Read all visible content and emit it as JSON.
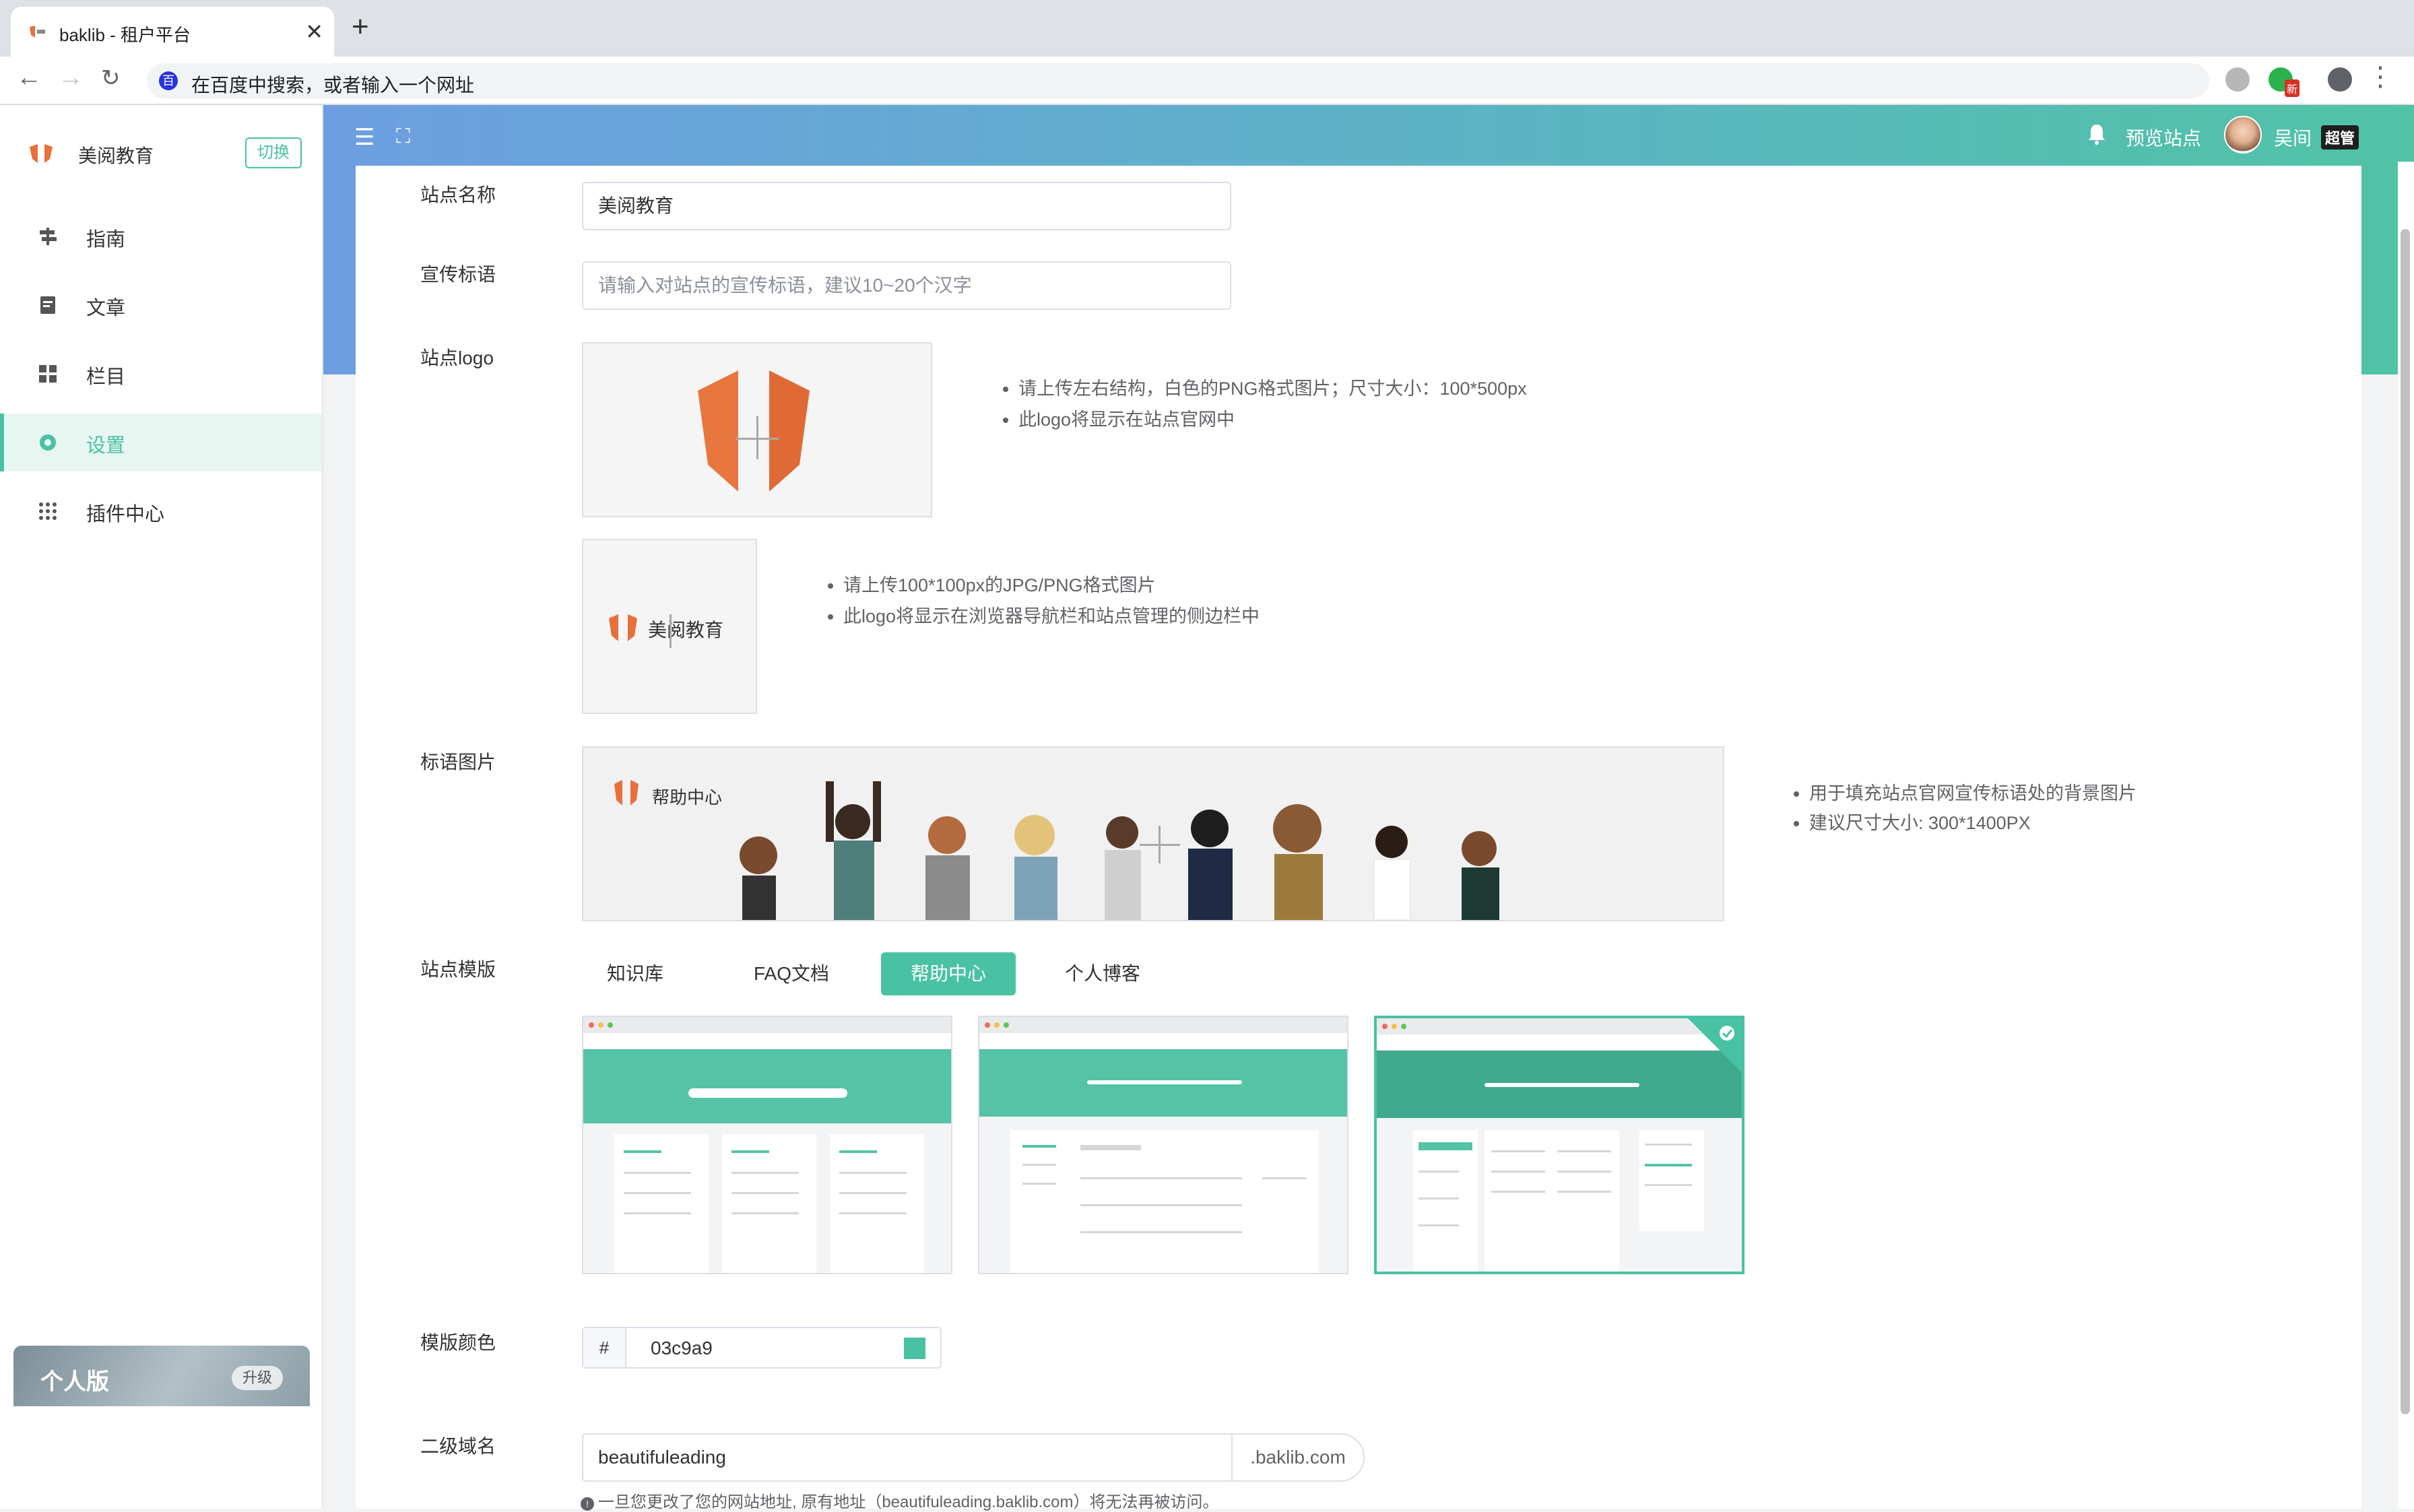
{
  "browser": {
    "tab_title": "baklib - 租户平台",
    "address_placeholder": "在百度中搜索，或者输入一个网址",
    "extension_badge": "新"
  },
  "sidebar": {
    "brand_name": "美阅教育",
    "switch_label": "切换",
    "items": [
      {
        "label": "指南",
        "icon": "signpost-icon",
        "active": false
      },
      {
        "label": "文章",
        "icon": "document-icon",
        "active": false
      },
      {
        "label": "栏目",
        "icon": "grid-icon",
        "active": false
      },
      {
        "label": "设置",
        "icon": "gear-icon",
        "active": true
      },
      {
        "label": "插件中心",
        "icon": "apps-icon",
        "active": false
      }
    ],
    "plan_name": "个人版",
    "upgrade_label": "升级"
  },
  "header": {
    "preview_label": "预览站点",
    "user_name": "吴间",
    "role_badge": "超管"
  },
  "form": {
    "site_name_label": "站点名称",
    "site_name_value": "美阅教育",
    "slogan_label": "宣传标语",
    "slogan_placeholder": "请输入对站点的宣传标语，建议10~20个汉字",
    "logo_label": "站点logo",
    "logo_tips": [
      "请上传左右结构，白色的PNG格式图片；尺寸大小：100*500px",
      "此logo将显示在站点官网中"
    ],
    "favicon_text": "美阅教育",
    "favicon_tips": [
      "请上传100*100px的JPG/PNG格式图片",
      "此logo将显示在浏览器导航栏和站点管理的侧边栏中"
    ],
    "banner_label": "标语图片",
    "banner_text": "帮助中心",
    "banner_tips": [
      "用于填充站点官网宣传标语处的背景图片",
      "建议尺寸大小: 300*1400PX"
    ],
    "template_label": "站点模版",
    "template_tabs": [
      {
        "label": "知识库",
        "active": false
      },
      {
        "label": "FAQ文档",
        "active": false
      },
      {
        "label": "帮助中心",
        "active": true
      },
      {
        "label": "个人博客",
        "active": false
      }
    ],
    "color_label": "模版颜色",
    "color_prefix": "#",
    "color_value": "03c9a9",
    "swatch_color": "#49c2a3",
    "domain_label": "二级域名",
    "domain_value": "beautifuleading",
    "domain_suffix": ".baklib.com",
    "domain_note": "一旦您更改了您的网站地址, 原有地址（beautifuleading.baklib.com）将无法再被访问。"
  },
  "colors": {
    "accent": "#49c2a3",
    "header_gradient_start": "#6d9ee1",
    "header_gradient_end": "#50c3a5"
  }
}
